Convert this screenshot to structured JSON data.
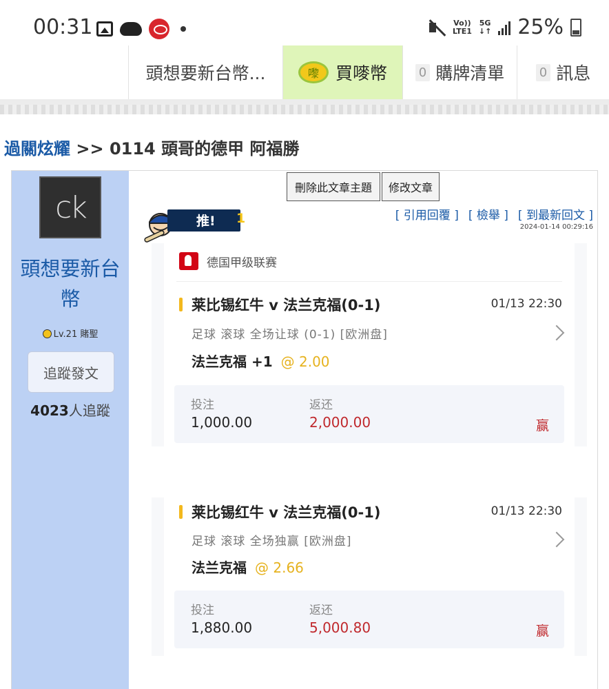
{
  "status_bar": {
    "time": "00:31",
    "network_top": "Vo))",
    "network_bottom": "LTE1",
    "fiveg": "5G",
    "battery": "25%"
  },
  "nav": {
    "user": "頭想要新台幣...",
    "coin_icon_text": "嚟",
    "buy_coin": "買嘜幣",
    "cart_count": "0",
    "cart": "購牌清單",
    "msg_count": "0",
    "messages": "訊息"
  },
  "breadcrumb": {
    "link": "過關炫耀",
    "sep": ">>",
    "title": "0114 頭哥的德甲 阿福勝"
  },
  "author": {
    "avatar_text": "ck",
    "name": "頭想要新台幣",
    "level": "Lv.21 賭聖",
    "follow_button": "追蹤發文",
    "followers_count": "4023",
    "followers_label": "人追蹤"
  },
  "post": {
    "delete_button": "刪除此文章主題",
    "edit_button": "修改文章",
    "push_label": "推!",
    "push_count": "1",
    "quote_link": "[ 引用回覆 ]",
    "report_link": "[ 檢舉 ]",
    "latest_link": "[ 到最新回文 ]",
    "timestamp": "2024-01-14 00:29:16"
  },
  "bets": [
    {
      "league": "德国甲级联赛",
      "match": "莱比锡红牛 v 法兰克福(0-1)",
      "time": "01/13 22:30",
      "type": "足球  滚球  全场让球 (0-1) [欧洲盘]",
      "pick": "法兰克福 +1",
      "odds": "@ 2.00",
      "stake_label": "投注",
      "stake": "1,000.00",
      "return_label": "返还",
      "return": "2,000.00",
      "result": "赢"
    },
    {
      "match": "莱比锡红牛 v 法兰克福(0-1)",
      "time": "01/13 22:30",
      "type": "足球  滚球  全场独赢  [欧洲盘]",
      "pick": "法兰克福",
      "odds": "@ 2.66",
      "stake_label": "投注",
      "stake": "1,880.00",
      "return_label": "返还",
      "return": "5,000.80",
      "result": "赢"
    }
  ]
}
